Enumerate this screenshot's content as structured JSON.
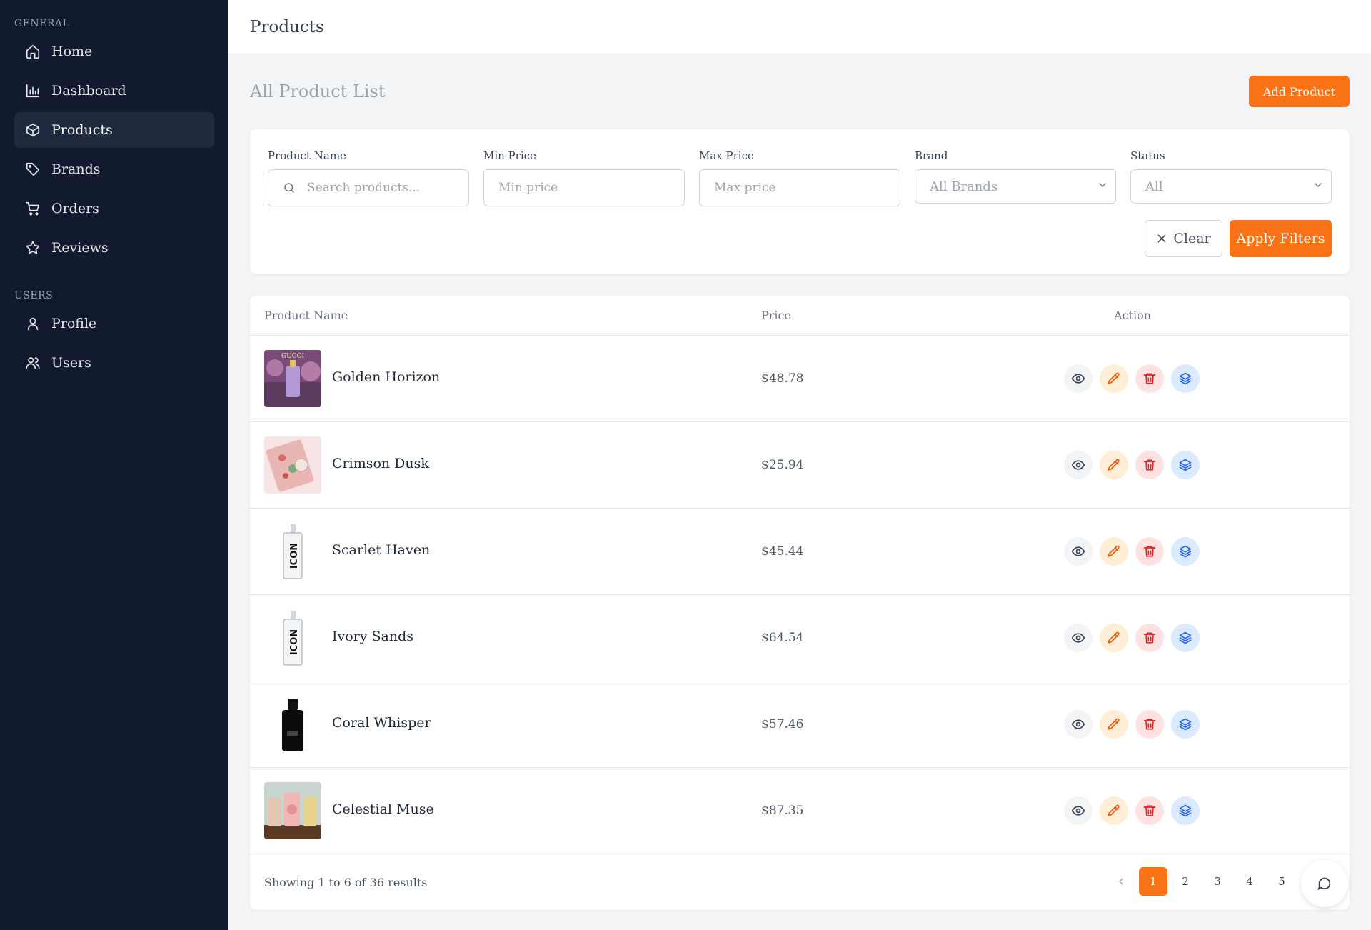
{
  "sidebar": {
    "general_title": "GENERAL",
    "users_title": "USERS",
    "general_items": [
      {
        "label": "Home",
        "icon": "home-icon"
      },
      {
        "label": "Dashboard",
        "icon": "bar-chart-icon"
      },
      {
        "label": "Products",
        "icon": "box-icon",
        "active": true
      },
      {
        "label": "Brands",
        "icon": "tag-icon"
      },
      {
        "label": "Orders",
        "icon": "cart-icon"
      },
      {
        "label": "Reviews",
        "icon": "star-icon"
      }
    ],
    "user_items": [
      {
        "label": "Profile",
        "icon": "user-icon"
      },
      {
        "label": "Users",
        "icon": "users-icon"
      }
    ]
  },
  "header": {
    "title": "Products"
  },
  "page": {
    "heading": "All Product List",
    "add_button": "Add Product"
  },
  "filters": {
    "product_name": {
      "label": "Product Name",
      "placeholder": "Search products..."
    },
    "min_price": {
      "label": "Min Price",
      "placeholder": "Min price"
    },
    "max_price": {
      "label": "Max Price",
      "placeholder": "Max price"
    },
    "brand": {
      "label": "Brand",
      "value": "All Brands"
    },
    "status": {
      "label": "Status",
      "value": "All"
    },
    "clear_button": "Clear",
    "apply_button": "Apply Filters"
  },
  "table": {
    "columns": [
      "Product Name",
      "Price",
      "Action"
    ],
    "rows": [
      {
        "name": "Golden Horizon",
        "price": "$48.78",
        "thumb_label": "GUCCI"
      },
      {
        "name": "Crimson Dusk",
        "price": "$25.94"
      },
      {
        "name": "Scarlet Haven",
        "price": "$45.44",
        "thumb_label": "ICON"
      },
      {
        "name": "Ivory Sands",
        "price": "$64.54",
        "thumb_label": "ICON"
      },
      {
        "name": "Coral Whisper",
        "price": "$57.46"
      },
      {
        "name": "Celestial Muse",
        "price": "$87.35"
      }
    ]
  },
  "pagination": {
    "info": "Showing 1 to 6 of 36 results",
    "pages": [
      "1",
      "2",
      "3",
      "4",
      "5"
    ],
    "current": "1"
  },
  "colors": {
    "accent": "#f97316",
    "sidebar_bg": "#111a2e"
  }
}
